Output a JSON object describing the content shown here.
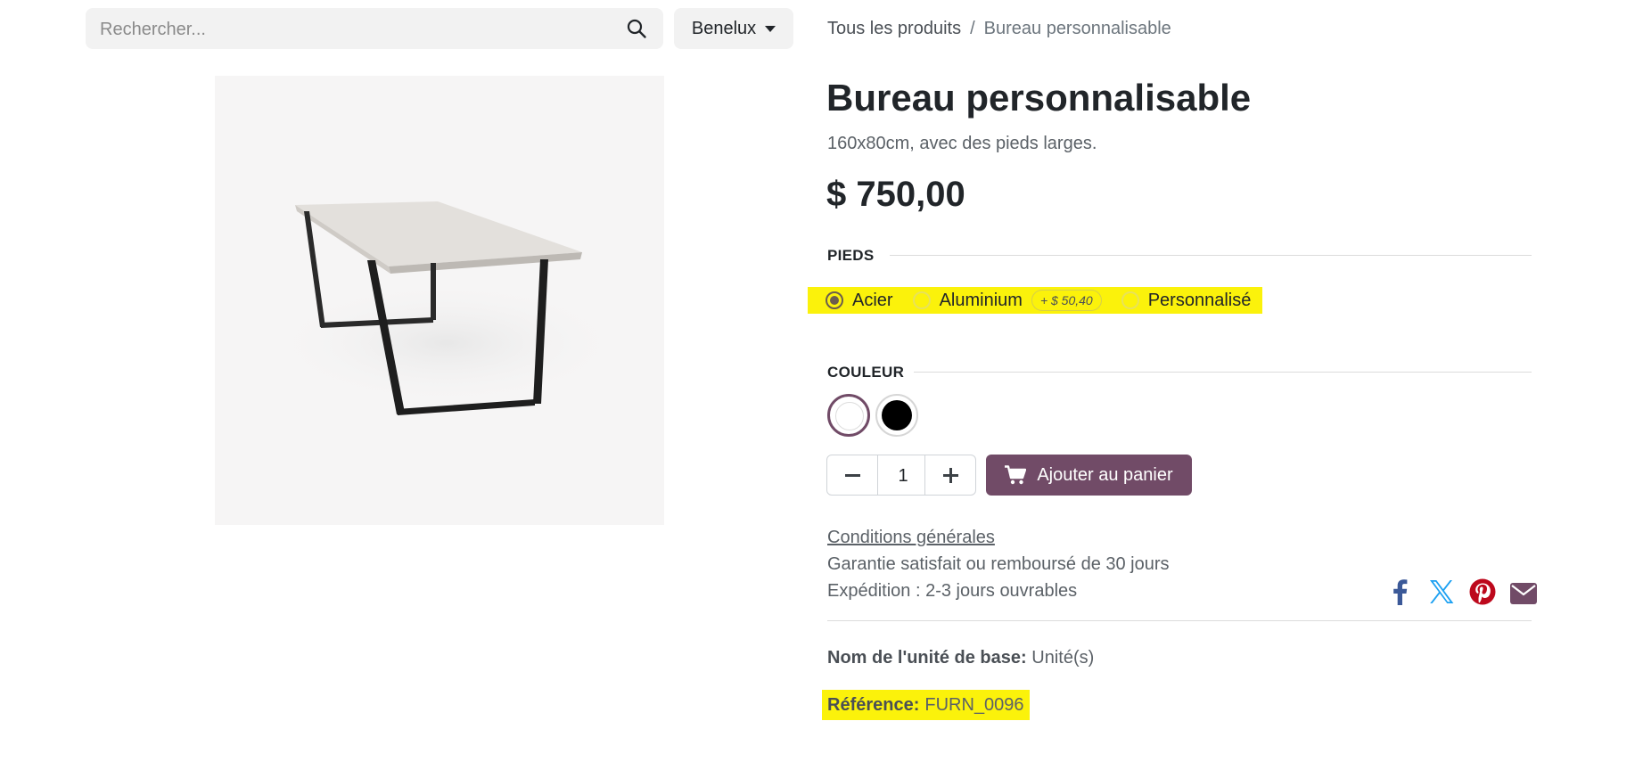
{
  "search": {
    "placeholder": "Rechercher...",
    "value": "",
    "icon": "search-icon"
  },
  "pricelist": {
    "label": "Benelux"
  },
  "breadcrumb": {
    "parent": "Tous les produits",
    "separator": "/",
    "current": "Bureau personnalisable"
  },
  "product": {
    "name": "Bureau personnalisable",
    "description": "160x80cm, avec des pieds larges.",
    "price": "$ 750,00",
    "image": "desk-image"
  },
  "attributes": {
    "legs": {
      "label": "PIEDS",
      "options": [
        {
          "label": "Acier",
          "selected": true
        },
        {
          "label": "Aluminium",
          "selected": false,
          "extra": "+ $ 50,40"
        },
        {
          "label": "Personnalisé",
          "selected": false
        }
      ]
    },
    "color": {
      "label": "COULEUR",
      "options": [
        {
          "name": "Blanc",
          "hex": "#ffffff",
          "selected": true
        },
        {
          "name": "Noir",
          "hex": "#000000",
          "selected": false
        }
      ]
    }
  },
  "cart": {
    "quantity": "1",
    "add_label": "Ajouter au panier",
    "button_color": "#714b67"
  },
  "info": {
    "terms": "Conditions générales",
    "guarantee": "Garantie satisfait ou remboursé de 30 jours",
    "shipping": "Expédition : 2-3 jours ouvrables"
  },
  "share": [
    {
      "icon": "facebook-icon",
      "color": "#3b5998"
    },
    {
      "icon": "x-twitter-icon",
      "color": "#1da1f2"
    },
    {
      "icon": "pinterest-icon",
      "color": "#bd081c"
    },
    {
      "icon": "email-icon",
      "color": "#714b67"
    }
  ],
  "details": {
    "uom_label": "Nom de l'unité de base:",
    "uom_value": "Unité(s)",
    "ref_label": "Référence:",
    "ref_value": "FURN_0096"
  },
  "colors": {
    "highlight": "#fbf20b",
    "primary": "#714b67"
  }
}
